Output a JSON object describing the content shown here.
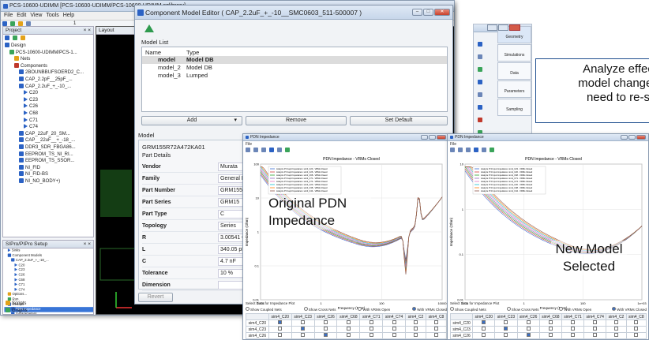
{
  "main_window": {
    "title": "PCS-10600-UDIMM [PCS-10600-UDIMM/PCS-10600-UDIMM.sqlibrary]",
    "menu": [
      "File",
      "Edit",
      "View",
      "Tools",
      "Help"
    ],
    "zoom_value": "1",
    "project_panel_title": "Project",
    "layout_tab": "Layout",
    "tree": [
      {
        "label": "Design",
        "indent": 0,
        "icon": "design"
      },
      {
        "label": "PCS-10600-UDIMM/PCS-1...",
        "indent": 1,
        "icon": "board"
      },
      {
        "label": "Nets",
        "indent": 2,
        "icon": "nets"
      },
      {
        "label": "Components",
        "indent": 2,
        "icon": "components"
      },
      {
        "label": "2BOUNBBUFSOERD2_C...",
        "indent": 3,
        "icon": "comp"
      },
      {
        "label": "CAP_2.2pF__25pF_...",
        "indent": 3,
        "icon": "comp"
      },
      {
        "label": "CAP_2.2uF_+_-10_...",
        "indent": 3,
        "icon": "comp"
      },
      {
        "label": "C20",
        "indent": 4,
        "icon": "pin"
      },
      {
        "label": "C23",
        "indent": 4,
        "icon": "pin"
      },
      {
        "label": "C26",
        "indent": 4,
        "icon": "pin"
      },
      {
        "label": "C68",
        "indent": 4,
        "icon": "pin"
      },
      {
        "label": "C71",
        "indent": 4,
        "icon": "pin"
      },
      {
        "label": "C74",
        "indent": 4,
        "icon": "pin"
      },
      {
        "label": "CAP_22uF_20_SM...",
        "indent": 3,
        "icon": "comp"
      },
      {
        "label": "CAP__22uF__+_-18_...",
        "indent": 3,
        "icon": "comp"
      },
      {
        "label": "DDR3_SDR_FBGA86...",
        "indent": 3,
        "icon": "comp"
      },
      {
        "label": "EEPROM_TS_NI_RI...",
        "indent": 3,
        "icon": "comp"
      },
      {
        "label": "EEPROM_TS_SSOR...",
        "indent": 3,
        "icon": "comp"
      },
      {
        "label": "NI_FID",
        "indent": 3,
        "icon": "comp"
      },
      {
        "label": "NI_FID-BS",
        "indent": 3,
        "icon": "comp"
      },
      {
        "label": "NI_NO_BODY+)",
        "indent": 3,
        "icon": "comp"
      }
    ],
    "setup_panel_title": "SIPro/PIPro Setup",
    "setup_tree": [
      {
        "label": "Sinks",
        "indent": 1,
        "icon": "pin"
      },
      {
        "label": "Component Models",
        "indent": 1,
        "icon": "comp"
      },
      {
        "label": "CAP_2.2uF_+_-18_...",
        "indent": 2,
        "icon": "comp"
      },
      {
        "label": "C20",
        "indent": 3,
        "icon": "pin"
      },
      {
        "label": "C23",
        "indent": 3,
        "icon": "pin"
      },
      {
        "label": "C26",
        "indent": 3,
        "icon": "pin"
      },
      {
        "label": "C68",
        "indent": 3,
        "icon": "pin"
      },
      {
        "label": "C71",
        "indent": 3,
        "icon": "pin"
      },
      {
        "label": "C74",
        "indent": 3,
        "icon": "pin"
      },
      {
        "label": "Options...",
        "indent": 1,
        "icon": "opt"
      },
      {
        "label": "Run",
        "indent": 1,
        "icon": "run"
      },
      {
        "label": "Results",
        "indent": 1,
        "icon": "res"
      },
      {
        "label": "PDN Impedance",
        "indent": 2,
        "icon": "res",
        "selected": true
      },
      {
        "label": "S-Parameters",
        "indent": 2,
        "icon": "res"
      },
      {
        "label": "Electric Field",
        "indent": 2,
        "icon": "res"
      },
      {
        "label": "Magnetic Field",
        "indent": 2,
        "icon": "res"
      },
      {
        "label": "Current Density",
        "indent": 2,
        "icon": "res"
      },
      {
        "label": "Generate Schemati...",
        "indent": 2,
        "icon": "res"
      }
    ],
    "scripts_label": "Scripts",
    "graphs_label": "Graphs",
    "side_buttons": [
      "Geometry",
      "Simulations",
      "Data",
      "Parameters",
      "Sampling"
    ]
  },
  "editor": {
    "title": "Component Model Editor ( CAP_2.2uF_+_-10__SMC0603_511-500007 )",
    "model_list_label": "Model List",
    "columns": [
      "Name",
      "Type"
    ],
    "rows": [
      {
        "name": "model",
        "type": "Model DB",
        "selected": true
      },
      {
        "name": "model_2",
        "type": "Model DB"
      },
      {
        "name": "model_3",
        "type": "Lumped"
      }
    ],
    "add_button": "Add",
    "remove_button": "Remove",
    "set_default_button": "Set Default",
    "model_label": "Model",
    "model_value": "GRM155R72A472KA01",
    "part_details_label": "Part Details",
    "details": [
      {
        "key": "Vendor",
        "value": "Murata"
      },
      {
        "key": "Family",
        "value": "General Pu"
      },
      {
        "key": "Part Number",
        "value": "GRM155R7"
      },
      {
        "key": "Part Series",
        "value": "GRM15"
      },
      {
        "key": "Part Type",
        "value": "C"
      },
      {
        "key": "Topology",
        "value": "Series"
      },
      {
        "key": "R",
        "value": "3.00541 O"
      },
      {
        "key": "L",
        "value": "340.05 pH"
      },
      {
        "key": "C",
        "value": "4.7 nF"
      },
      {
        "key": "Tolerance",
        "value": "10 %"
      },
      {
        "key": "Dimension",
        "value": ""
      }
    ],
    "revert_button": "Revert"
  },
  "plot_left": {
    "window_title": "PDN Impedance",
    "menu": "File",
    "plot_title": "PDN Impedance - VRMs Closed",
    "xlabel": "Frequency (MHz)",
    "ylabel": "Impedance (Ohm)",
    "legend": [
      "Analyze P:3 tap4 Impedance: sim3_C23 - VRMs Closed",
      "Analyze P:3 tap4 Impedance: sim3_C26 - VRMs Closed",
      "Analyze P:3 tap4 Impedance: sim3_C68 - VRMs Closed",
      "Analyze P:3 tap4 Impedance: sim3_C71 - VRMs Closed",
      "Analyze P:3 tap4 Impedance: sim3_C74 - VRMs Closed",
      "Analyze P:3 tap4 Impedance: sim3_C20 - VRMs Closed",
      "Analyze P:3 tap4 Impedance: sim3_C38 - VRMs Closed",
      "Analyze P:3 tap4 Impedance: sim3_C44 - VRMs Closed"
    ],
    "y_ticks": [
      "100",
      "10",
      "1",
      "0.1",
      "0.01"
    ],
    "x_ticks": [
      "0.001",
      "1",
      "100",
      "10000"
    ],
    "select_label": "Select Data for Impedance Plot",
    "radio_options": [
      "Show Coupled Nets",
      "Show Cross Nets",
      "With VRMs Open",
      "With VRMs Closed"
    ],
    "table_header": [
      "",
      "sim4_C20",
      "sim4_C23",
      "sim4_C26",
      "sim4_C68",
      "sim4_C71",
      "sim4_C74",
      "sim4_C2",
      "sim4_C8"
    ],
    "table_rows": [
      "sim4_C20",
      "sim4_C23",
      "sim4_C26",
      "sim4_C68",
      "sim4_C71"
    ],
    "annotation": "Original PDN Impedance"
  },
  "plot_right": {
    "window_title": "PDN Impedance",
    "menu": "File",
    "plot_title": "PDN Impedance - VRMs Closed",
    "xlabel": "Frequency (MHz)",
    "ylabel": "Impedance (Ohm)",
    "legend": [
      "Analyze P:3 Input Impedance: sim4_C23 - VRMs Closed",
      "Analyze P:3 Input Impedance: sim4_C26 - VRMs Closed",
      "Analyze P:3 Input Impedance: sim4_C68 - VRMs Closed",
      "Analyze P:3 Input Impedance: sim4_C71 - VRMs Closed",
      "Analyze P:3 Input Impedance: sim4_C74 - VRMs Closed",
      "Analyze P:3 Input Impedance: sim4_C20 - VRMs Closed",
      "Analyze P:3 Input Impedance: sim4_C38 - VRMs Closed",
      "Analyze P:3 Input Impedance: sim4_C44 - VRMs Closed"
    ],
    "y_ticks": [
      "10",
      "1",
      "0.1",
      "0.01"
    ],
    "x_ticks": [
      "0.01",
      "1",
      "100",
      "1e+03"
    ],
    "select_label": "Select Data for Impedance Plot",
    "radio_options": [
      "Show Coupled Nets",
      "Show Cross Nets",
      "With VRMs Open",
      "With VRMs Closed"
    ],
    "table_header": [
      "",
      "sim4_C20",
      "sim4_C23",
      "sim4_C26",
      "sim4_C68",
      "sim4_C71",
      "sim4_C74",
      "sim4_C2",
      "sim4_C8"
    ],
    "table_rows": [
      "sim4_C20",
      "sim4_C23",
      "sim4_C26",
      "sim4_C68",
      "sim4_C71"
    ],
    "annotation": "New Model Selected"
  },
  "callout": {
    "lines": [
      "Analyze effec",
      "model changes",
      "need to re-s"
    ]
  },
  "colors": {
    "curves": [
      "#3c6fd1",
      "#d23c3c",
      "#2ca02c",
      "#9467bd",
      "#e377c2",
      "#17becf",
      "#ff7f0e",
      "#8c564b"
    ]
  }
}
